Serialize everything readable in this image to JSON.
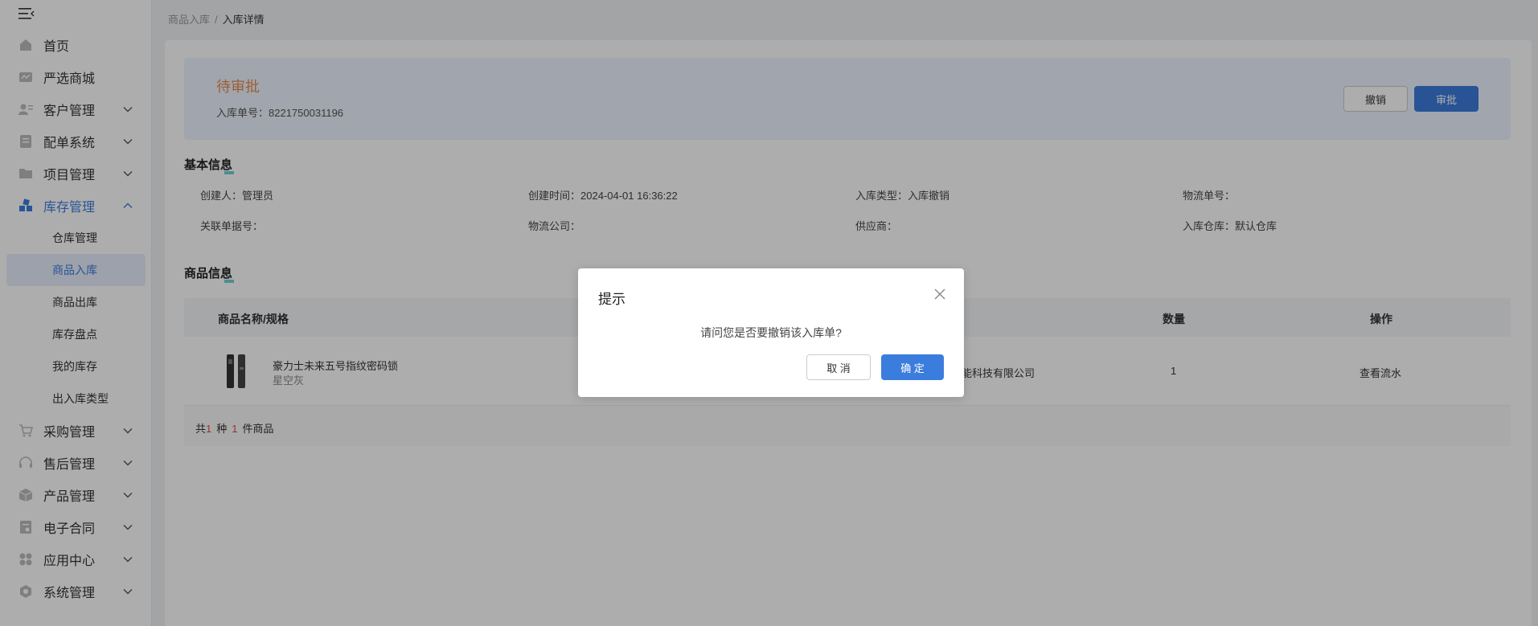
{
  "sidebar": {
    "items": [
      {
        "label": "首页",
        "icon": "home-icon",
        "has_arrow": false
      },
      {
        "label": "严选商城",
        "icon": "mall-icon",
        "has_arrow": false
      },
      {
        "label": "客户管理",
        "icon": "customer-icon",
        "has_arrow": true
      },
      {
        "label": "配单系统",
        "icon": "order-config-icon",
        "has_arrow": true
      },
      {
        "label": "项目管理",
        "icon": "folder-icon",
        "has_arrow": true
      },
      {
        "label": "库存管理",
        "icon": "inventory-icon",
        "has_arrow": true,
        "open": true
      }
    ],
    "sub_items": [
      "仓库管理",
      "商品入库",
      "商品出库",
      "库存盘点",
      "我的库存",
      "出入库类型"
    ],
    "active_sub": "商品入库",
    "items_after": [
      {
        "label": "采购管理",
        "icon": "cart-icon"
      },
      {
        "label": "售后管理",
        "icon": "headset-icon"
      },
      {
        "label": "产品管理",
        "icon": "box-icon"
      },
      {
        "label": "电子合同",
        "icon": "contract-icon"
      },
      {
        "label": "应用中心",
        "icon": "apps-icon"
      },
      {
        "label": "系统管理",
        "icon": "settings-icon"
      }
    ]
  },
  "breadcrumb": {
    "parent": "商品入库",
    "separator": "/",
    "current": "入库详情"
  },
  "status": {
    "title": "待审批",
    "order_no_label": "入库单号：",
    "order_no": "8221750031196",
    "revoke_label": "撤销",
    "approve_label": "审批"
  },
  "basic_info": {
    "title": "基本信息",
    "fields": [
      {
        "label": "创建人：",
        "value": "管理员"
      },
      {
        "label": "创建时间：",
        "value": "2024-04-01 16:36:22"
      },
      {
        "label": "入库类型：",
        "value": "入库撤销"
      },
      {
        "label": "物流单号：",
        "value": ""
      },
      {
        "label": "关联单据号：",
        "value": ""
      },
      {
        "label": "物流公司：",
        "value": ""
      },
      {
        "label": "供应商：",
        "value": ""
      },
      {
        "label": "入库仓库：",
        "value": "默认仓库"
      }
    ]
  },
  "goods_info": {
    "title": "商品信息",
    "columns": {
      "name": "商品名称/规格",
      "quantity": "数量",
      "action": "操作"
    },
    "rows": [
      {
        "name": "豪力士未来五号指纹密码锁",
        "spec": "星空灰",
        "supplier": "能科技有限公司",
        "quantity": "1",
        "action": "查看流水"
      }
    ],
    "footer": {
      "prefix": "共",
      "kinds": "1",
      "mid": "种",
      "pieces": "1",
      "suffix": "件商品"
    }
  },
  "dialog": {
    "title": "提示",
    "message": "请问您是否要撤销该入库单?",
    "cancel_label": "取 消",
    "ok_label": "确 定"
  },
  "colors": {
    "accent": "#3b7ddd",
    "status": "#e8894c",
    "count": "#e0474c"
  }
}
